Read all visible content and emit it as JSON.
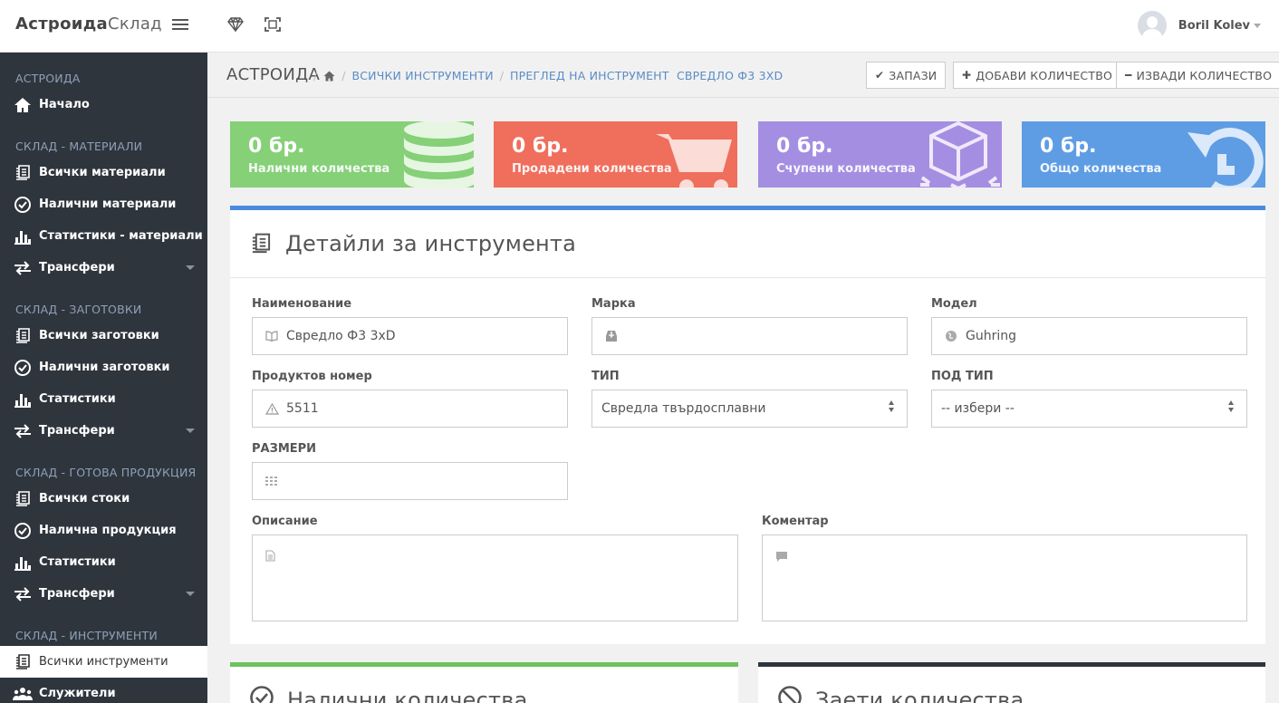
{
  "topbar": {
    "brand_bold": "Астроида",
    "brand_light": "Склад",
    "menu_icon": "hamburger-icon",
    "icons": [
      "diamond-icon",
      "fullscreen-icon"
    ],
    "user": {
      "name": "Boril Kolev",
      "avatar": "user-avatar-icon"
    }
  },
  "sidebar": {
    "sections": [
      {
        "title": "АСТРОИДА",
        "items": [
          {
            "label": "Начало",
            "icon": "home-icon"
          }
        ]
      },
      {
        "title": "СКЛАД - МАТЕРИАЛИ",
        "items": [
          {
            "label": "Всички материали",
            "icon": "stack-icon"
          },
          {
            "label": "Налични материали",
            "icon": "check-circle-icon"
          },
          {
            "label": "Статистики - материали",
            "icon": "bar-chart-icon"
          },
          {
            "label": "Трансфери",
            "icon": "transfer-icon",
            "dropdown": true
          }
        ]
      },
      {
        "title": "СКЛАД - ЗАГОТОВКИ",
        "items": [
          {
            "label": "Всички заготовки",
            "icon": "stack-icon"
          },
          {
            "label": "Налични заготовки",
            "icon": "check-circle-icon"
          },
          {
            "label": "Статистики",
            "icon": "bar-chart-icon"
          },
          {
            "label": "Трансфери",
            "icon": "transfer-icon",
            "dropdown": true
          }
        ]
      },
      {
        "title": "СКЛАД - ГОТОВА ПРОДУКЦИЯ",
        "items": [
          {
            "label": "Всички стоки",
            "icon": "stack-icon"
          },
          {
            "label": "Налична продукция",
            "icon": "check-circle-icon"
          },
          {
            "label": "Статистики",
            "icon": "bar-chart-icon"
          },
          {
            "label": "Трансфери",
            "icon": "transfer-icon",
            "dropdown": true
          }
        ]
      },
      {
        "title": "СКЛАД - ИНСТРУМЕНТИ",
        "items": [
          {
            "label": "Всички инструменти",
            "icon": "stack-icon",
            "active": true
          },
          {
            "label": "Служители",
            "icon": "users-icon"
          }
        ]
      }
    ]
  },
  "breadcrumb": {
    "title": "АСТРОИДА",
    "home_icon": "home-icon",
    "links": [
      "ВСИЧКИ ИНСТРУМЕНТИ",
      "ПРЕГЛЕД НА ИНСТРУМЕНТ  СВРЕДЛО Ф3 3XD"
    ]
  },
  "actions": {
    "save": {
      "label": "ЗАПАЗИ",
      "icon": "check-icon"
    },
    "add": {
      "label": "ДОБАВИ КОЛИЧЕСТВО",
      "icon": "plus-icon"
    },
    "remove": {
      "label": "ИЗВАДИ КОЛИЧЕСТВО",
      "icon": "minus-icon"
    }
  },
  "stats": [
    {
      "value": "0 бр.",
      "label": "Налични количества",
      "color": "#86d078",
      "icon": "database-icon"
    },
    {
      "value": "0 бр.",
      "label": "Продадени количества",
      "color": "#ef6e5c",
      "icon": "cart-icon"
    },
    {
      "value": "0 бр.",
      "label": "Счупени количества",
      "color": "#a48ee2",
      "icon": "broken-cube-icon"
    },
    {
      "value": "0 бр.",
      "label": "Общо количества",
      "color": "#5e9de4",
      "icon": "refresh-icon"
    }
  ],
  "details": {
    "title": "Детайли за инструмента",
    "icon": "stack-icon",
    "fields": {
      "name": {
        "label": "Наименование",
        "value": "Свредло Ф3 3xD",
        "icon": "book-icon"
      },
      "brand": {
        "label": "Марка",
        "value": "",
        "icon": "inbox-icon"
      },
      "model": {
        "label": "Модел",
        "value": "Guhring",
        "icon": "globe-icon"
      },
      "product_number": {
        "label": "Продуктов номер",
        "value": "5511",
        "icon": "warning-icon"
      },
      "type": {
        "label": "ТИП",
        "value": "Свредла твърдосплавни"
      },
      "subtype": {
        "label": "ПОД ТИП",
        "value": "-- избери --"
      },
      "sizes": {
        "label": "РАЗМЕРИ",
        "value": "",
        "icon": "grid-icon"
      },
      "description": {
        "label": "Описание",
        "value": "",
        "icon": "document-icon"
      },
      "comment": {
        "label": "Коментар",
        "value": "",
        "icon": "comment-icon"
      }
    }
  },
  "bottom_cards": [
    {
      "title": "Налични количества",
      "icon": "check-circle-icon",
      "color": "#6cc25c"
    },
    {
      "title": "Заети количества",
      "icon": "ban-icon",
      "color": "#2f353d"
    }
  ]
}
